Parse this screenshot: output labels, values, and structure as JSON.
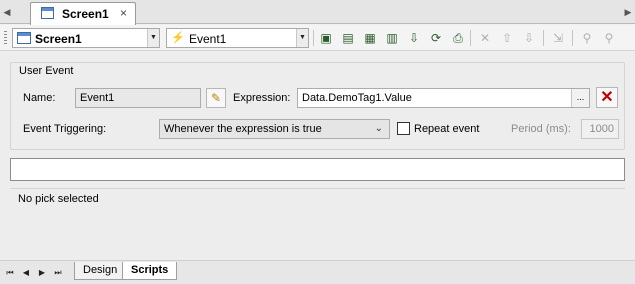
{
  "document_tab": {
    "label": "Screen1",
    "close_glyph": "×",
    "scroll_left_glyph": "◀",
    "scroll_right_glyph": "▶"
  },
  "toolbar": {
    "screen_value": "Screen1",
    "event_value": "Event1",
    "combo_glyph": "▼",
    "icons": [
      "add-event-icon",
      "add-item-icon",
      "screen-properties-icon",
      "add-script-icon",
      "import-icon",
      "refresh-icon",
      "print-icon",
      "delete-icon",
      "move-up-icon",
      "move-down-icon",
      "trace-icon",
      "find-icon",
      "find-replace-icon"
    ]
  },
  "user_event": {
    "group_title": "User Event",
    "name_label": "Name:",
    "name_value": "Event1",
    "expression_label": "Expression:",
    "expression_value": "Data.DemoTag1.Value",
    "ellipsis_label": "...",
    "triggering_label": "Event Triggering:",
    "triggering_value": "Whenever the expression is true",
    "repeat_label": "Repeat event",
    "repeat_checked": false,
    "period_label": "Period (ms):",
    "period_value": "1000"
  },
  "pick_panel": {
    "status_text": "No pick selected"
  },
  "bottom_tabs": {
    "tabs": [
      {
        "label": "Design",
        "active": false
      },
      {
        "label": "Scripts",
        "active": true
      }
    ]
  }
}
